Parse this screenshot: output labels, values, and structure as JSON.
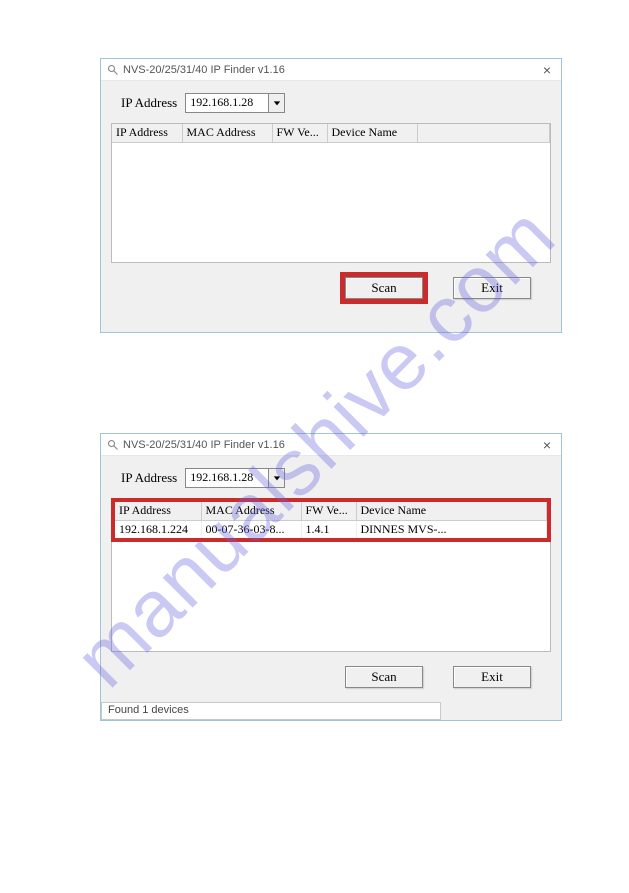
{
  "watermark": "manualshive.com",
  "window1": {
    "title": "NVS-20/25/31/40 IP Finder v1.16",
    "ip_label": "IP Address",
    "ip_value": "192.168.1.28",
    "columns": {
      "c0": "IP Address",
      "c1": "MAC Address",
      "c2": "FW Ve...",
      "c3": "Device Name"
    },
    "scan_label": "Scan",
    "exit_label": "Exit"
  },
  "window2": {
    "title": "NVS-20/25/31/40 IP Finder v1.16",
    "ip_label": "IP Address",
    "ip_value": "192.168.1.28",
    "columns": {
      "c0": "IP Address",
      "c1": "MAC Address",
      "c2": "FW Ve...",
      "c3": "Device Name"
    },
    "row0": {
      "c0": "192.168.1.224",
      "c1": "00-07-36-03-8...",
      "c2": "1.4.1",
      "c3": "DINNES MVS-..."
    },
    "scan_label": "Scan",
    "exit_label": "Exit",
    "status": "Found 1 devices"
  }
}
